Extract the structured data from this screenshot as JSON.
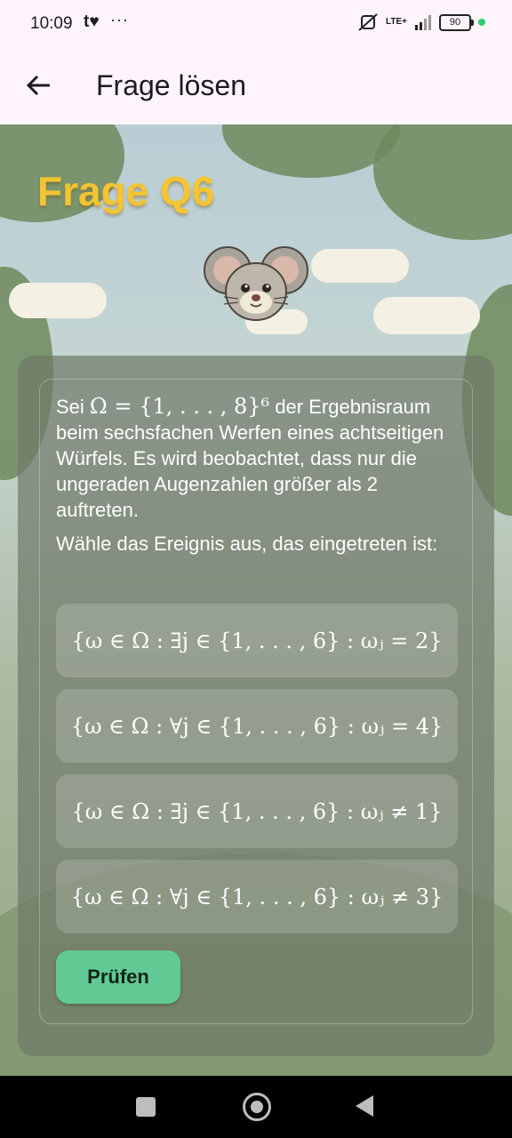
{
  "status_bar": {
    "time": "10:09",
    "notification": "t♥",
    "dots": "···",
    "network": "LTE+",
    "battery": "90"
  },
  "app_bar": {
    "title": "Frage lösen"
  },
  "quiz": {
    "heading": "Frage Q6",
    "question_prefix": "Sei",
    "question_math": "Ω = {1, . . . , 8}⁶",
    "question_text": "der Ergebnisraum beim sechsfachen Werfen eines achtseitigen Würfels. Es wird beobachtet, dass nur die ungeraden Augenzahlen größer als 2 auftreten.",
    "prompt": "Wähle das Ereignis aus, das eingetreten ist:",
    "options": [
      "{ω ∈ Ω : ∃j ∈ {1, . . . , 6} : ωⱼ = 2}",
      "{ω ∈ Ω : ∀j ∈ {1, . . . , 6} : ωⱼ = 4}",
      "{ω ∈ Ω : ∃j ∈ {1, . . . , 6} : ωⱼ ≠ 1}",
      "{ω ∈ Ω : ∀j ∈ {1, . . . , 6} : ωⱼ ≠ 3}"
    ],
    "check_button": "Prüfen"
  },
  "colors": {
    "heading": "#f4c431",
    "check_button": "#62c994"
  }
}
